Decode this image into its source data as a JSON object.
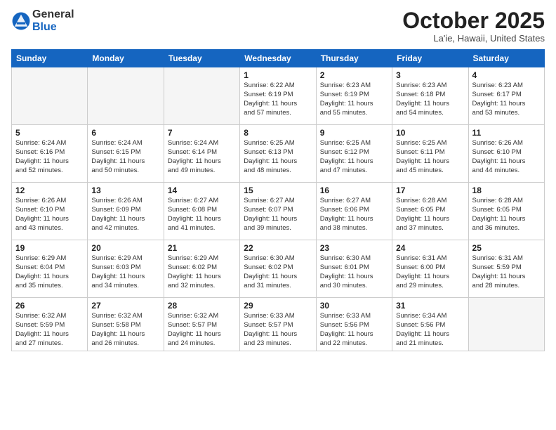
{
  "header": {
    "logo_general": "General",
    "logo_blue": "Blue",
    "month": "October 2025",
    "location": "La'ie, Hawaii, United States"
  },
  "weekdays": [
    "Sunday",
    "Monday",
    "Tuesday",
    "Wednesday",
    "Thursday",
    "Friday",
    "Saturday"
  ],
  "weeks": [
    [
      {
        "day": "",
        "info": ""
      },
      {
        "day": "",
        "info": ""
      },
      {
        "day": "",
        "info": ""
      },
      {
        "day": "1",
        "info": "Sunrise: 6:22 AM\nSunset: 6:19 PM\nDaylight: 11 hours\nand 57 minutes."
      },
      {
        "day": "2",
        "info": "Sunrise: 6:23 AM\nSunset: 6:19 PM\nDaylight: 11 hours\nand 55 minutes."
      },
      {
        "day": "3",
        "info": "Sunrise: 6:23 AM\nSunset: 6:18 PM\nDaylight: 11 hours\nand 54 minutes."
      },
      {
        "day": "4",
        "info": "Sunrise: 6:23 AM\nSunset: 6:17 PM\nDaylight: 11 hours\nand 53 minutes."
      }
    ],
    [
      {
        "day": "5",
        "info": "Sunrise: 6:24 AM\nSunset: 6:16 PM\nDaylight: 11 hours\nand 52 minutes."
      },
      {
        "day": "6",
        "info": "Sunrise: 6:24 AM\nSunset: 6:15 PM\nDaylight: 11 hours\nand 50 minutes."
      },
      {
        "day": "7",
        "info": "Sunrise: 6:24 AM\nSunset: 6:14 PM\nDaylight: 11 hours\nand 49 minutes."
      },
      {
        "day": "8",
        "info": "Sunrise: 6:25 AM\nSunset: 6:13 PM\nDaylight: 11 hours\nand 48 minutes."
      },
      {
        "day": "9",
        "info": "Sunrise: 6:25 AM\nSunset: 6:12 PM\nDaylight: 11 hours\nand 47 minutes."
      },
      {
        "day": "10",
        "info": "Sunrise: 6:25 AM\nSunset: 6:11 PM\nDaylight: 11 hours\nand 45 minutes."
      },
      {
        "day": "11",
        "info": "Sunrise: 6:26 AM\nSunset: 6:10 PM\nDaylight: 11 hours\nand 44 minutes."
      }
    ],
    [
      {
        "day": "12",
        "info": "Sunrise: 6:26 AM\nSunset: 6:10 PM\nDaylight: 11 hours\nand 43 minutes."
      },
      {
        "day": "13",
        "info": "Sunrise: 6:26 AM\nSunset: 6:09 PM\nDaylight: 11 hours\nand 42 minutes."
      },
      {
        "day": "14",
        "info": "Sunrise: 6:27 AM\nSunset: 6:08 PM\nDaylight: 11 hours\nand 41 minutes."
      },
      {
        "day": "15",
        "info": "Sunrise: 6:27 AM\nSunset: 6:07 PM\nDaylight: 11 hours\nand 39 minutes."
      },
      {
        "day": "16",
        "info": "Sunrise: 6:27 AM\nSunset: 6:06 PM\nDaylight: 11 hours\nand 38 minutes."
      },
      {
        "day": "17",
        "info": "Sunrise: 6:28 AM\nSunset: 6:05 PM\nDaylight: 11 hours\nand 37 minutes."
      },
      {
        "day": "18",
        "info": "Sunrise: 6:28 AM\nSunset: 6:05 PM\nDaylight: 11 hours\nand 36 minutes."
      }
    ],
    [
      {
        "day": "19",
        "info": "Sunrise: 6:29 AM\nSunset: 6:04 PM\nDaylight: 11 hours\nand 35 minutes."
      },
      {
        "day": "20",
        "info": "Sunrise: 6:29 AM\nSunset: 6:03 PM\nDaylight: 11 hours\nand 34 minutes."
      },
      {
        "day": "21",
        "info": "Sunrise: 6:29 AM\nSunset: 6:02 PM\nDaylight: 11 hours\nand 32 minutes."
      },
      {
        "day": "22",
        "info": "Sunrise: 6:30 AM\nSunset: 6:02 PM\nDaylight: 11 hours\nand 31 minutes."
      },
      {
        "day": "23",
        "info": "Sunrise: 6:30 AM\nSunset: 6:01 PM\nDaylight: 11 hours\nand 30 minutes."
      },
      {
        "day": "24",
        "info": "Sunrise: 6:31 AM\nSunset: 6:00 PM\nDaylight: 11 hours\nand 29 minutes."
      },
      {
        "day": "25",
        "info": "Sunrise: 6:31 AM\nSunset: 5:59 PM\nDaylight: 11 hours\nand 28 minutes."
      }
    ],
    [
      {
        "day": "26",
        "info": "Sunrise: 6:32 AM\nSunset: 5:59 PM\nDaylight: 11 hours\nand 27 minutes."
      },
      {
        "day": "27",
        "info": "Sunrise: 6:32 AM\nSunset: 5:58 PM\nDaylight: 11 hours\nand 26 minutes."
      },
      {
        "day": "28",
        "info": "Sunrise: 6:32 AM\nSunset: 5:57 PM\nDaylight: 11 hours\nand 24 minutes."
      },
      {
        "day": "29",
        "info": "Sunrise: 6:33 AM\nSunset: 5:57 PM\nDaylight: 11 hours\nand 23 minutes."
      },
      {
        "day": "30",
        "info": "Sunrise: 6:33 AM\nSunset: 5:56 PM\nDaylight: 11 hours\nand 22 minutes."
      },
      {
        "day": "31",
        "info": "Sunrise: 6:34 AM\nSunset: 5:56 PM\nDaylight: 11 hours\nand 21 minutes."
      },
      {
        "day": "",
        "info": ""
      }
    ]
  ]
}
